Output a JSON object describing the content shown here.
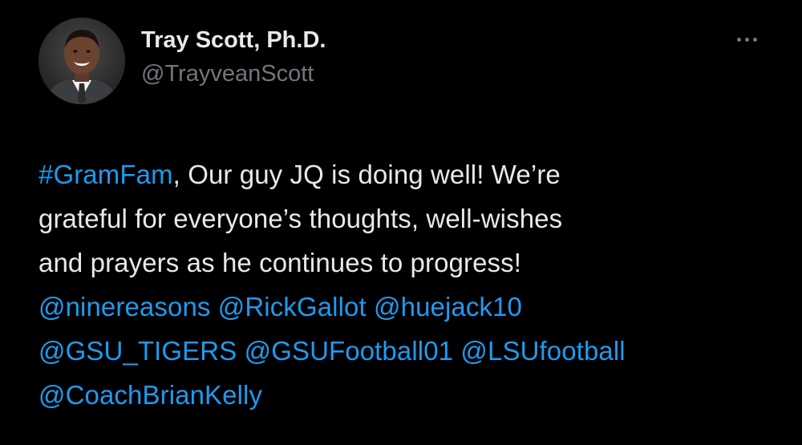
{
  "author": {
    "display_name": "Tray Scott, Ph.D.",
    "handle": "@TrayveanScott",
    "avatar_icon": "profile-photo"
  },
  "more_icon": "more-horizontal-icon",
  "colors": {
    "background": "#000000",
    "text": "#e7e9ea",
    "secondary": "#71767b",
    "link": "#1d9bf0"
  },
  "tweet": {
    "hashtag": "#GramFam",
    "line1_rest": ", Our guy JQ is doing well! We’re",
    "line2": "grateful for everyone’s thoughts, well-wishes",
    "line3": "and prayers as he continues to progress!",
    "mentions": [
      "@ninereasons",
      "@RickGallot",
      "@huejack10",
      "@GSU_TIGERS",
      "@GSUFootball01",
      "@LSUfootball",
      "@CoachBrianKelly"
    ]
  }
}
